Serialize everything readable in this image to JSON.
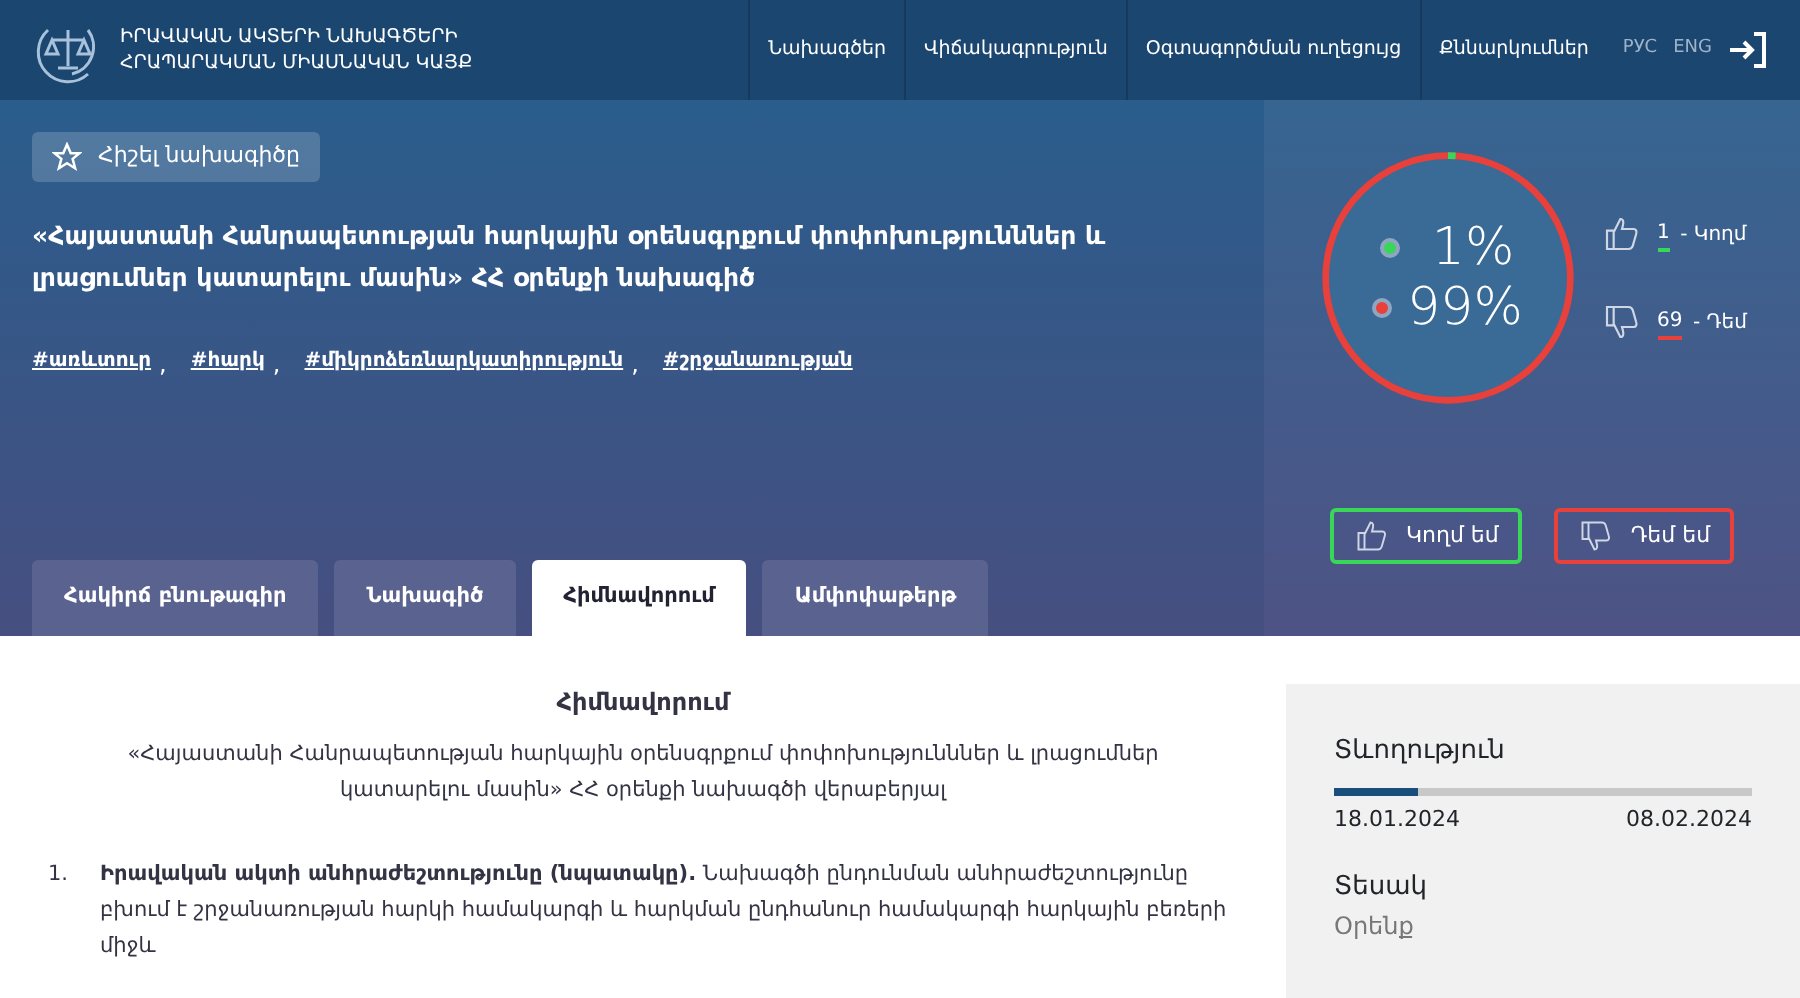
{
  "header": {
    "site_title_lines": [
      "ԻՐԱՎԱԿԱՆ ԱԿՏԵՐԻ ՆԱԽԱԳԾԵՐԻ",
      "ՀՐԱՊԱՐԱԿՄԱՆ ՄԻԱՍՆԱԿԱՆ ԿԱՅՔ"
    ],
    "nav": [
      {
        "label": "Նախագծեր"
      },
      {
        "label": "Վիճակագրություն"
      },
      {
        "label": "Օգտագործման ուղեցույց"
      },
      {
        "label": "Քննարկումներ"
      }
    ],
    "languages": [
      {
        "label": "РУС"
      },
      {
        "label": "ENG"
      }
    ]
  },
  "hero": {
    "bookmark_label": "Հիշել նախագիծը",
    "title": "«Հայաստանի Հանրապետության հարկային օրենսգրքում փոփոխությունններ և լրացումներ կատարելու մասին» ՀՀ օրենքի նախագիծ",
    "tags": [
      {
        "label": "#առևտուր",
        "separator": ","
      },
      {
        "label": "#հարկ",
        "separator": ","
      },
      {
        "label": "#միկրոձեռնարկատիրություն",
        "separator": ","
      },
      {
        "label": "#շրջանառության"
      }
    ]
  },
  "voting": {
    "ring": {
      "level": 0.01
    },
    "for_percent": "1%",
    "against_percent": "99%",
    "for_count": "1",
    "for_label": " - Կողմ",
    "against_count": "69",
    "against_label": " - Դեմ",
    "for_button": "Կողմ եմ",
    "against_button": "Դեմ եմ"
  },
  "tabs": [
    {
      "label": "Հակիրճ բնութագիր",
      "selected": false
    },
    {
      "label": "Նախագիծ",
      "selected": false
    },
    {
      "label": "Հիմնավորում",
      "selected": true
    },
    {
      "label": "Ամփոփաթերթ",
      "selected": false
    }
  ],
  "content": {
    "heading": "Հիմնավորում",
    "subtitle": "«Հայաստանի Հանրապետության հարկային օրենսգրքում փոփոխությունններ և լրացումներ կատարելու մասին» ՀՀ օրենքի նախագծի վերաբերյալ",
    "items": [
      {
        "number": "1.",
        "text": "**Իրավական ակտի անհրաժեշտությունը (նպատակը).** Նախագծի ընդունման անհրաժեշտությունը բխում է շրջանառության հարկի համակարգի և հարկման ընդհանուր համակարգի հարկային բեռերի միջև"
      }
    ]
  },
  "sidebar": {
    "duration_label": "Տևողություն",
    "progress": {
      "level": 0.2
    },
    "start_date": "18.01.2024",
    "end_date": "08.02.2024",
    "type_label": "Տեսակ",
    "type_value": "Օրենք"
  }
}
